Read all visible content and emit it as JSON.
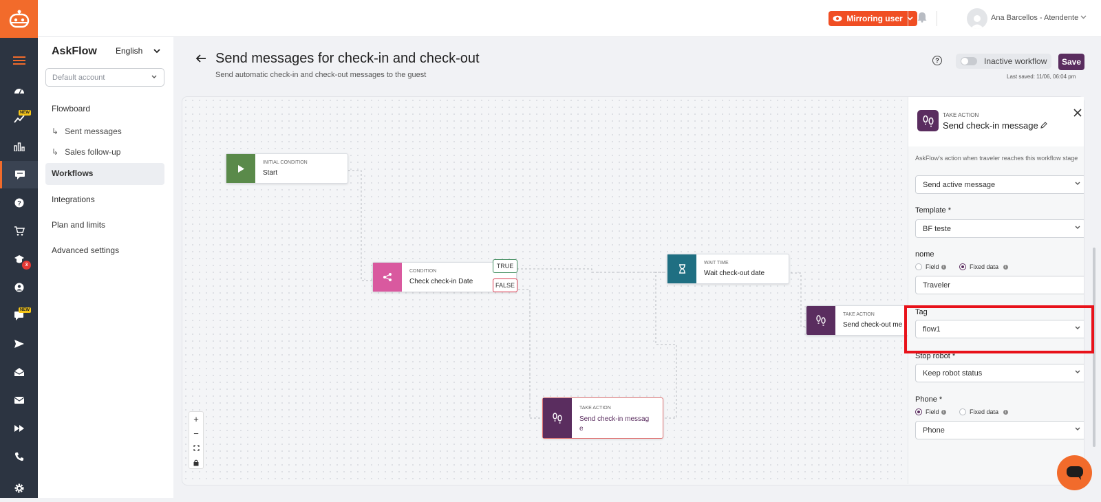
{
  "app": {
    "brand": "AskFlow",
    "language": "English"
  },
  "topbar": {
    "mirroring_label": "Mirroring user",
    "user_name": "Ana Barcellos - Atendente"
  },
  "rail": {
    "items": [
      {
        "icon": "menu-icon"
      },
      {
        "icon": "dashboard-icon"
      },
      {
        "icon": "trend-icon",
        "badge": "NEW"
      },
      {
        "icon": "bar-chart-icon"
      },
      {
        "icon": "workflows-icon",
        "active": true
      },
      {
        "icon": "help-icon"
      },
      {
        "icon": "cart-icon"
      },
      {
        "icon": "graduation-icon",
        "count": "3"
      },
      {
        "icon": "user-icon"
      },
      {
        "icon": "chat-icon",
        "badge": "NEW"
      },
      {
        "icon": "send-icon"
      },
      {
        "icon": "inbox-icon"
      },
      {
        "icon": "mail-icon"
      },
      {
        "icon": "fast-forward-icon"
      },
      {
        "icon": "phone-icon"
      },
      {
        "icon": "settings-icon"
      }
    ]
  },
  "sidebar": {
    "account_placeholder": "Default account",
    "items": [
      {
        "label": "Flowboard"
      },
      {
        "label": "Sent messages",
        "prefix": "↳"
      },
      {
        "label": "Sales follow-up",
        "prefix": "↳"
      },
      {
        "label": "Workflows",
        "active": true
      },
      {
        "label": "Integrations"
      },
      {
        "label": "Plan and limits"
      },
      {
        "label": "Advanced settings"
      }
    ]
  },
  "header": {
    "title": "Send messages for check-in and check-out",
    "subtitle": "Send automatic check-in and check-out messages to the guest",
    "toggle_label": "Inactive workflow",
    "save_label": "Save",
    "last_saved": "Last saved: 11/06, 06:04 pm"
  },
  "flow": {
    "nodes": [
      {
        "kind": "INITIAL CONDITION",
        "name": "Start",
        "color": "#5a8a4a"
      },
      {
        "kind": "CONDITION",
        "name": "Check check-in Date",
        "color": "#d9599f"
      },
      {
        "kind": "WAIT TIME",
        "name": "Wait check-out date",
        "color": "#1f6f82"
      },
      {
        "kind": "TAKE ACTION",
        "name": "Send check-out me",
        "color": "#5a2d5f"
      },
      {
        "kind": "TAKE ACTION",
        "name": "Send check-in messag\ne",
        "color": "#5a2d5f"
      }
    ],
    "true_label": "TRUE",
    "false_label": "FALSE"
  },
  "panel": {
    "kind": "TAKE ACTION",
    "name": "Send check-in message",
    "description": "AskFlow's action when traveler reaches this workflow stage",
    "action_value": "Send active message",
    "template_label": "Template *",
    "template_value": "BF teste",
    "nome_label": "nome",
    "field_label": "Field",
    "fixed_label": "Fixed data",
    "nome_value": "Traveler",
    "tag_label": "Tag",
    "tag_value": "flow1",
    "stop_label": "Stop robot *",
    "stop_value": "Keep robot status",
    "phone_label": "Phone *",
    "phone_value": "Phone"
  },
  "colors": {
    "accent": "#f26b2b",
    "brand_purple": "#5a2d5f",
    "highlight": "#e8121a"
  }
}
